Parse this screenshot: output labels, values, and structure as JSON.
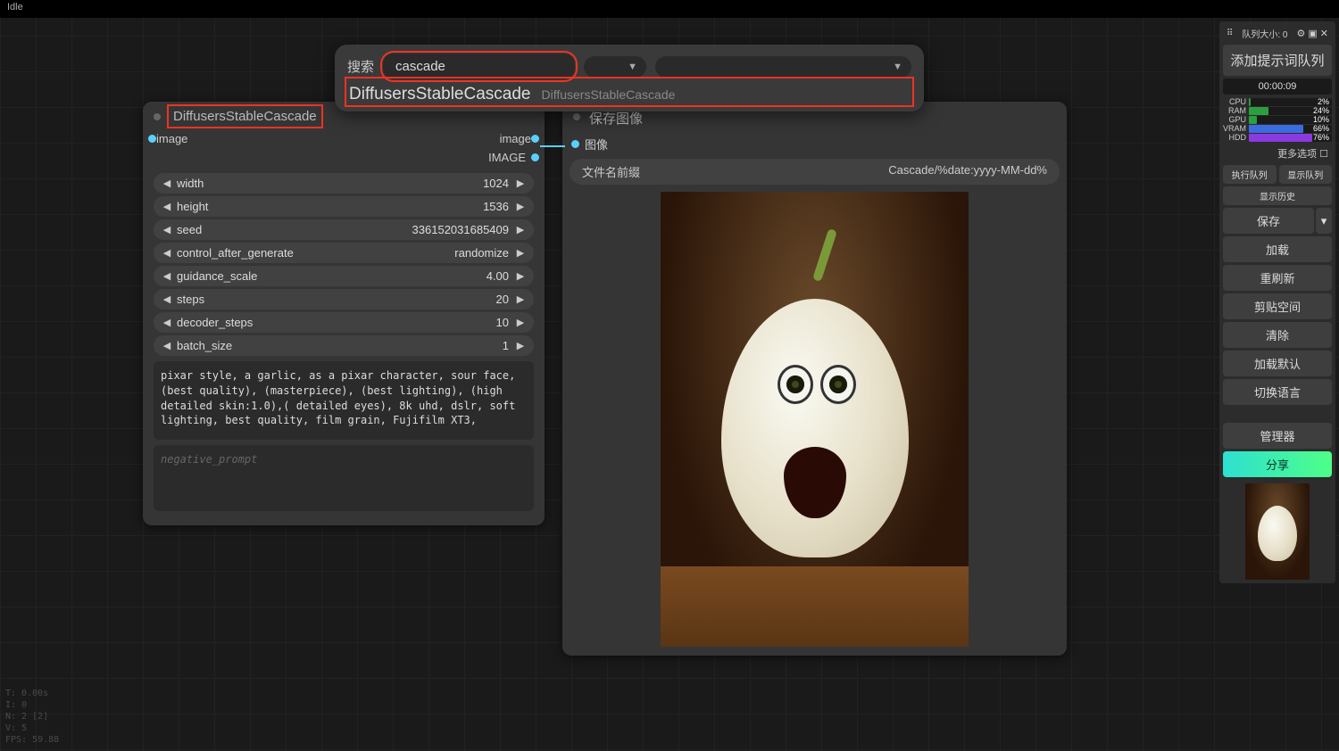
{
  "topbar": {
    "status": "Idle"
  },
  "search": {
    "label": "搜索",
    "value": "cascade",
    "result_main": "DiffusersStableCascade",
    "result_sub": "DiffusersStableCascade"
  },
  "node_cascade": {
    "title": "DiffusersStableCascade",
    "out1": "image",
    "out2": "IMAGE",
    "in1": "image",
    "params": [
      {
        "label": "width",
        "value": "1024"
      },
      {
        "label": "height",
        "value": "1536"
      },
      {
        "label": "seed",
        "value": "336152031685409"
      },
      {
        "label": "control_after_generate",
        "value": "randomize"
      },
      {
        "label": "guidance_scale",
        "value": "4.00"
      },
      {
        "label": "steps",
        "value": "20"
      },
      {
        "label": "decoder_steps",
        "value": "10"
      },
      {
        "label": "batch_size",
        "value": "1"
      }
    ],
    "prompt": "pixar style, a garlic, as a pixar character, sour face, (best quality), (masterpiece), (best lighting), (high detailed skin:1.0),( detailed eyes), 8k uhd, dslr, soft lighting, best quality, film grain, Fujifilm XT3,",
    "neg_placeholder": "negative_prompt"
  },
  "node_save": {
    "title": "保存图像",
    "port_in": "图像",
    "filename_label": "文件名前缀",
    "filename_value": "Cascade/%date:yyyy-MM-dd%"
  },
  "rpanel": {
    "queue_size_label": "队列大小: 0",
    "enqueue": "添加提示词队列",
    "timer": "00:00:09",
    "meters": [
      {
        "label": "CPU",
        "pct": 2,
        "color": "#2b9e3f"
      },
      {
        "label": "RAM",
        "pct": 24,
        "color": "#2b9e3f"
      },
      {
        "label": "GPU",
        "pct": 10,
        "color": "#2b9e3f"
      },
      {
        "label": "VRAM",
        "pct": 66,
        "color": "#3a6ce0"
      },
      {
        "label": "HDD",
        "pct": 76,
        "color": "#8a3ae0"
      }
    ],
    "more": "更多选项",
    "exec_queue": "执行队列",
    "show_queue": "显示队列",
    "show_history": "显示历史",
    "save": "保存",
    "load": "加载",
    "refresh": "重刷新",
    "clipspace": "剪贴空间",
    "clear": "清除",
    "load_default": "加载默认",
    "switch_lang": "切换语言",
    "manager": "管理器",
    "share": "分享"
  },
  "blstats": {
    "l1": "T: 0.00s",
    "l2": "I: 0",
    "l3": "N: 2 [2]",
    "l4": "V: 5",
    "l5": "FPS: 59.88"
  }
}
